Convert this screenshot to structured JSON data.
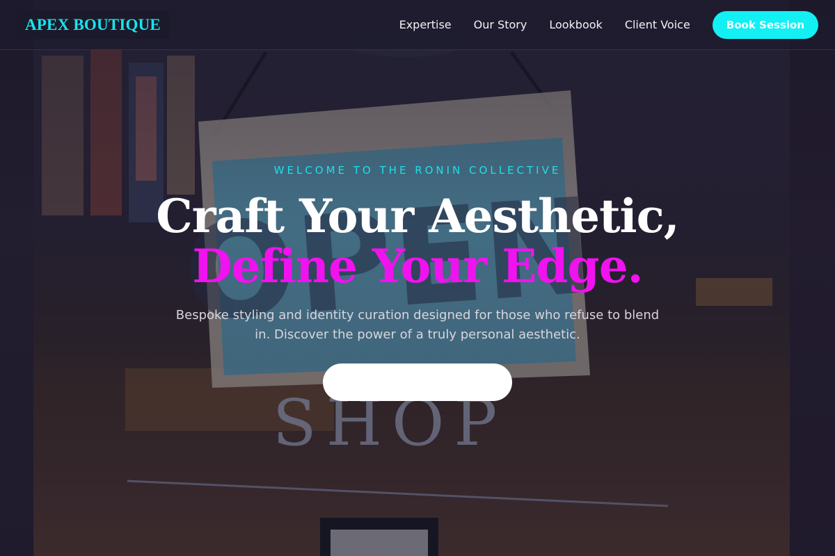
{
  "brand": {
    "name": "APEX BOUTIQUE",
    "color": "#19e3ee"
  },
  "nav": {
    "links": [
      {
        "label": "Expertise"
      },
      {
        "label": "Our Story"
      },
      {
        "label": "Lookbook"
      },
      {
        "label": "Client Voice"
      }
    ],
    "cta_label": "Book Session",
    "cta_color": "#12f0f4"
  },
  "hero": {
    "eyebrow": "WELCOME TO THE RONIN COLLECTIVE",
    "headline_line1": "Craft Your Aesthetic,",
    "headline_line2": "Define Your Edge.",
    "subtext": "Bespoke styling and identity curation designed for those who refuse to blend in. Discover the power of a truly personal aesthetic.",
    "cta_label": "",
    "accent_color": "#f012ef",
    "background_sign_text": "OPEN",
    "background_door_text": "SHOP"
  }
}
